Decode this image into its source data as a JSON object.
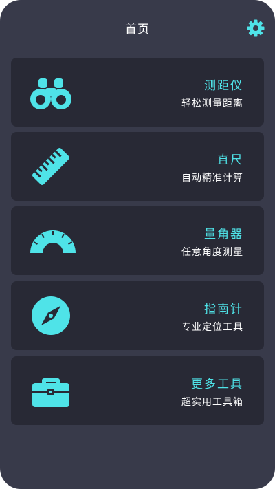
{
  "header": {
    "title": "首页",
    "settings_icon": "gear-icon"
  },
  "colors": {
    "background": "#383a4a",
    "card": "#282935",
    "accent": "#4fe3e8",
    "text": "#ffffff"
  },
  "tools": [
    {
      "name": "测距仪",
      "desc": "轻松测量距离",
      "icon": "binoculars-icon"
    },
    {
      "name": "直尺",
      "desc": "自动精准计算",
      "icon": "ruler-icon"
    },
    {
      "name": "量角器",
      "desc": "任意角度测量",
      "icon": "protractor-icon"
    },
    {
      "name": "指南针",
      "desc": "专业定位工具",
      "icon": "compass-icon"
    },
    {
      "name": "更多工具",
      "desc": "超实用工具箱",
      "icon": "toolbox-icon"
    }
  ]
}
